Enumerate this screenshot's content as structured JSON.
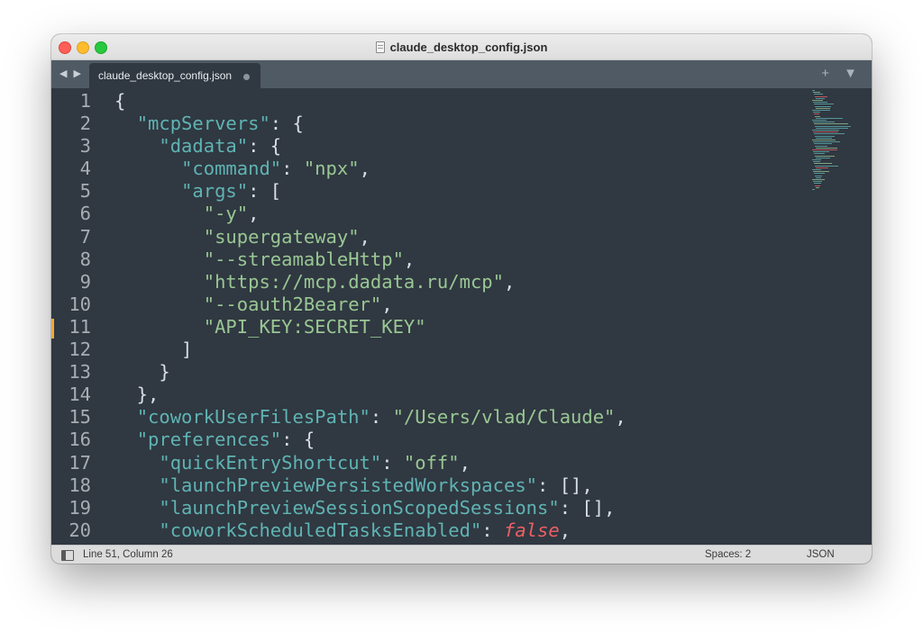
{
  "window": {
    "title": "claude_desktop_config.json"
  },
  "tabbar": {
    "nav_arrows": "◀ ▶",
    "active_tab": "claude_desktop_config.json",
    "actions": "+ ▼"
  },
  "editor": {
    "lines": [
      {
        "n": "1",
        "tokens": [
          {
            "t": "p",
            "v": "{"
          }
        ]
      },
      {
        "n": "2",
        "tokens": [
          {
            "t": "p",
            "v": "  "
          },
          {
            "t": "k",
            "v": "\"mcpServers\""
          },
          {
            "t": "p",
            "v": ": {"
          }
        ]
      },
      {
        "n": "3",
        "tokens": [
          {
            "t": "p",
            "v": "    "
          },
          {
            "t": "k",
            "v": "\"dadata\""
          },
          {
            "t": "p",
            "v": ": {"
          }
        ]
      },
      {
        "n": "4",
        "tokens": [
          {
            "t": "p",
            "v": "      "
          },
          {
            "t": "k",
            "v": "\"command\""
          },
          {
            "t": "p",
            "v": ": "
          },
          {
            "t": "s",
            "v": "\"npx\""
          },
          {
            "t": "p",
            "v": ","
          }
        ]
      },
      {
        "n": "5",
        "tokens": [
          {
            "t": "p",
            "v": "      "
          },
          {
            "t": "k",
            "v": "\"args\""
          },
          {
            "t": "p",
            "v": ": ["
          }
        ]
      },
      {
        "n": "6",
        "tokens": [
          {
            "t": "p",
            "v": "        "
          },
          {
            "t": "s",
            "v": "\"-y\""
          },
          {
            "t": "p",
            "v": ","
          }
        ]
      },
      {
        "n": "7",
        "tokens": [
          {
            "t": "p",
            "v": "        "
          },
          {
            "t": "s",
            "v": "\"supergateway\""
          },
          {
            "t": "p",
            "v": ","
          }
        ]
      },
      {
        "n": "8",
        "tokens": [
          {
            "t": "p",
            "v": "        "
          },
          {
            "t": "s",
            "v": "\"--streamableHttp\""
          },
          {
            "t": "p",
            "v": ","
          }
        ]
      },
      {
        "n": "9",
        "tokens": [
          {
            "t": "p",
            "v": "        "
          },
          {
            "t": "s",
            "v": "\"https://mcp.dadata.ru/mcp\""
          },
          {
            "t": "p",
            "v": ","
          }
        ]
      },
      {
        "n": "10",
        "tokens": [
          {
            "t": "p",
            "v": "        "
          },
          {
            "t": "s",
            "v": "\"--oauth2Bearer\""
          },
          {
            "t": "p",
            "v": ","
          }
        ]
      },
      {
        "n": "11",
        "tokens": [
          {
            "t": "p",
            "v": "        "
          },
          {
            "t": "s",
            "v": "\"API_KEY:SECRET_KEY\""
          }
        ]
      },
      {
        "n": "12",
        "tokens": [
          {
            "t": "p",
            "v": "      ]"
          }
        ]
      },
      {
        "n": "13",
        "tokens": [
          {
            "t": "p",
            "v": "    }"
          }
        ]
      },
      {
        "n": "14",
        "tokens": [
          {
            "t": "p",
            "v": "  },"
          }
        ]
      },
      {
        "n": "15",
        "tokens": [
          {
            "t": "p",
            "v": "  "
          },
          {
            "t": "k",
            "v": "\"coworkUserFilesPath\""
          },
          {
            "t": "p",
            "v": ": "
          },
          {
            "t": "s",
            "v": "\"/Users/vlad/Claude\""
          },
          {
            "t": "p",
            "v": ","
          }
        ]
      },
      {
        "n": "16",
        "tokens": [
          {
            "t": "p",
            "v": "  "
          },
          {
            "t": "k",
            "v": "\"preferences\""
          },
          {
            "t": "p",
            "v": ": {"
          }
        ]
      },
      {
        "n": "17",
        "tokens": [
          {
            "t": "p",
            "v": "    "
          },
          {
            "t": "k",
            "v": "\"quickEntryShortcut\""
          },
          {
            "t": "p",
            "v": ": "
          },
          {
            "t": "s",
            "v": "\"off\""
          },
          {
            "t": "p",
            "v": ","
          }
        ]
      },
      {
        "n": "18",
        "tokens": [
          {
            "t": "p",
            "v": "    "
          },
          {
            "t": "k",
            "v": "\"launchPreviewPersistedWorkspaces\""
          },
          {
            "t": "p",
            "v": ": [],"
          }
        ]
      },
      {
        "n": "19",
        "tokens": [
          {
            "t": "p",
            "v": "    "
          },
          {
            "t": "k",
            "v": "\"launchPreviewSessionScopedSessions\""
          },
          {
            "t": "p",
            "v": ": [],"
          }
        ]
      },
      {
        "n": "20",
        "tokens": [
          {
            "t": "p",
            "v": "    "
          },
          {
            "t": "k",
            "v": "\"coworkScheduledTasksEnabled\""
          },
          {
            "t": "p",
            "v": ": "
          },
          {
            "t": "b",
            "v": "false"
          },
          {
            "t": "p",
            "v": ","
          }
        ]
      }
    ]
  },
  "statusbar": {
    "position": "Line 51, Column 26",
    "spaces": "Spaces: 2",
    "syntax": "JSON"
  },
  "colors": {
    "editor_bg": "#303841",
    "key": "#5fb4b4",
    "string": "#99c794",
    "boolean": "#ec5f66",
    "gutter_modified": "#f2a93b"
  }
}
